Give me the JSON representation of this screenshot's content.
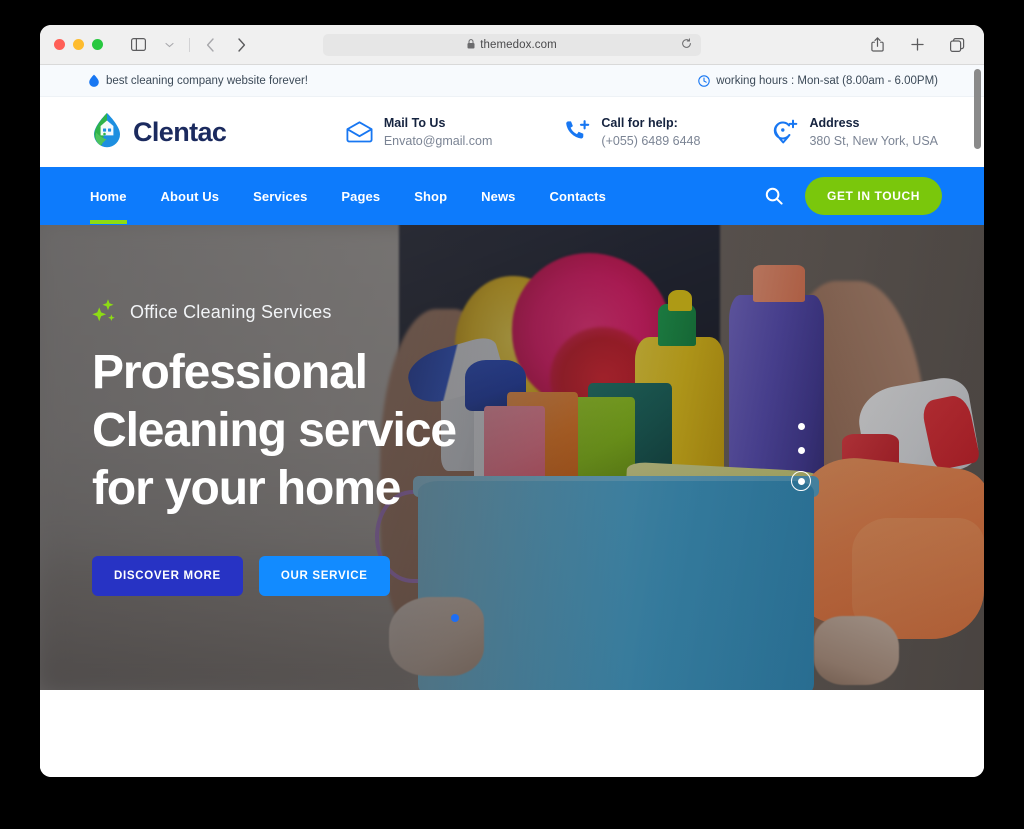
{
  "browser": {
    "url": "themedox.com",
    "lock_icon": "lock-icon",
    "reload_icon": "reload-icon",
    "sidebar_icon": "sidebar-toggle-icon",
    "chevron_icon": "chevron-down-icon",
    "back_icon": "back-arrow-icon",
    "forward_icon": "forward-arrow-icon",
    "share_icon": "share-icon",
    "new_tab_icon": "plus-icon",
    "tabs_icon": "tab-overview-icon"
  },
  "announcement": {
    "left_icon": "droplet-icon",
    "left_text": "best cleaning company website forever!",
    "right_icon": "clock-icon",
    "right_text": "working hours : Mon-sat (8.00am - 6.00PM)"
  },
  "header": {
    "logo_icon": "clentac-droplet-house-logo",
    "brand": "Clentac",
    "contacts": [
      {
        "icon": "envelope-icon",
        "title": "Mail To Us",
        "value": "Envato@gmail.com"
      },
      {
        "icon": "phone-plus-icon",
        "title": "Call for help:",
        "value": "(+055) 6489 6448"
      },
      {
        "icon": "map-pin-plus-icon",
        "title": "Address",
        "value": "380 St, New York, USA"
      }
    ]
  },
  "nav": {
    "items": [
      {
        "label": "Home",
        "active": true
      },
      {
        "label": "About Us",
        "active": false
      },
      {
        "label": "Services",
        "active": false
      },
      {
        "label": "Pages",
        "active": false
      },
      {
        "label": "Shop",
        "active": false
      },
      {
        "label": "News",
        "active": false
      },
      {
        "label": "Contacts",
        "active": false
      }
    ],
    "search_icon": "search-icon",
    "cta_label": "GET IN TOUCH",
    "bar_color": "#0d7bfc",
    "cta_color": "#7ac70c",
    "active_underline_color": "#8ddc14"
  },
  "hero": {
    "eyebrow_icon": "sparkle-icon",
    "eyebrow": "Office Cleaning Services",
    "title_line1": "Professional",
    "title_line2": "Cleaning service",
    "title_line3": "for your home",
    "primary_button": "DISCOVER MORE",
    "secondary_button": "OUR SERVICE",
    "primary_color": "#2733c4",
    "secondary_color": "#128bff",
    "slider_dots": 3,
    "slider_active_index": 2,
    "image_alt": "person holding blue cleaning bucket with supplies"
  }
}
